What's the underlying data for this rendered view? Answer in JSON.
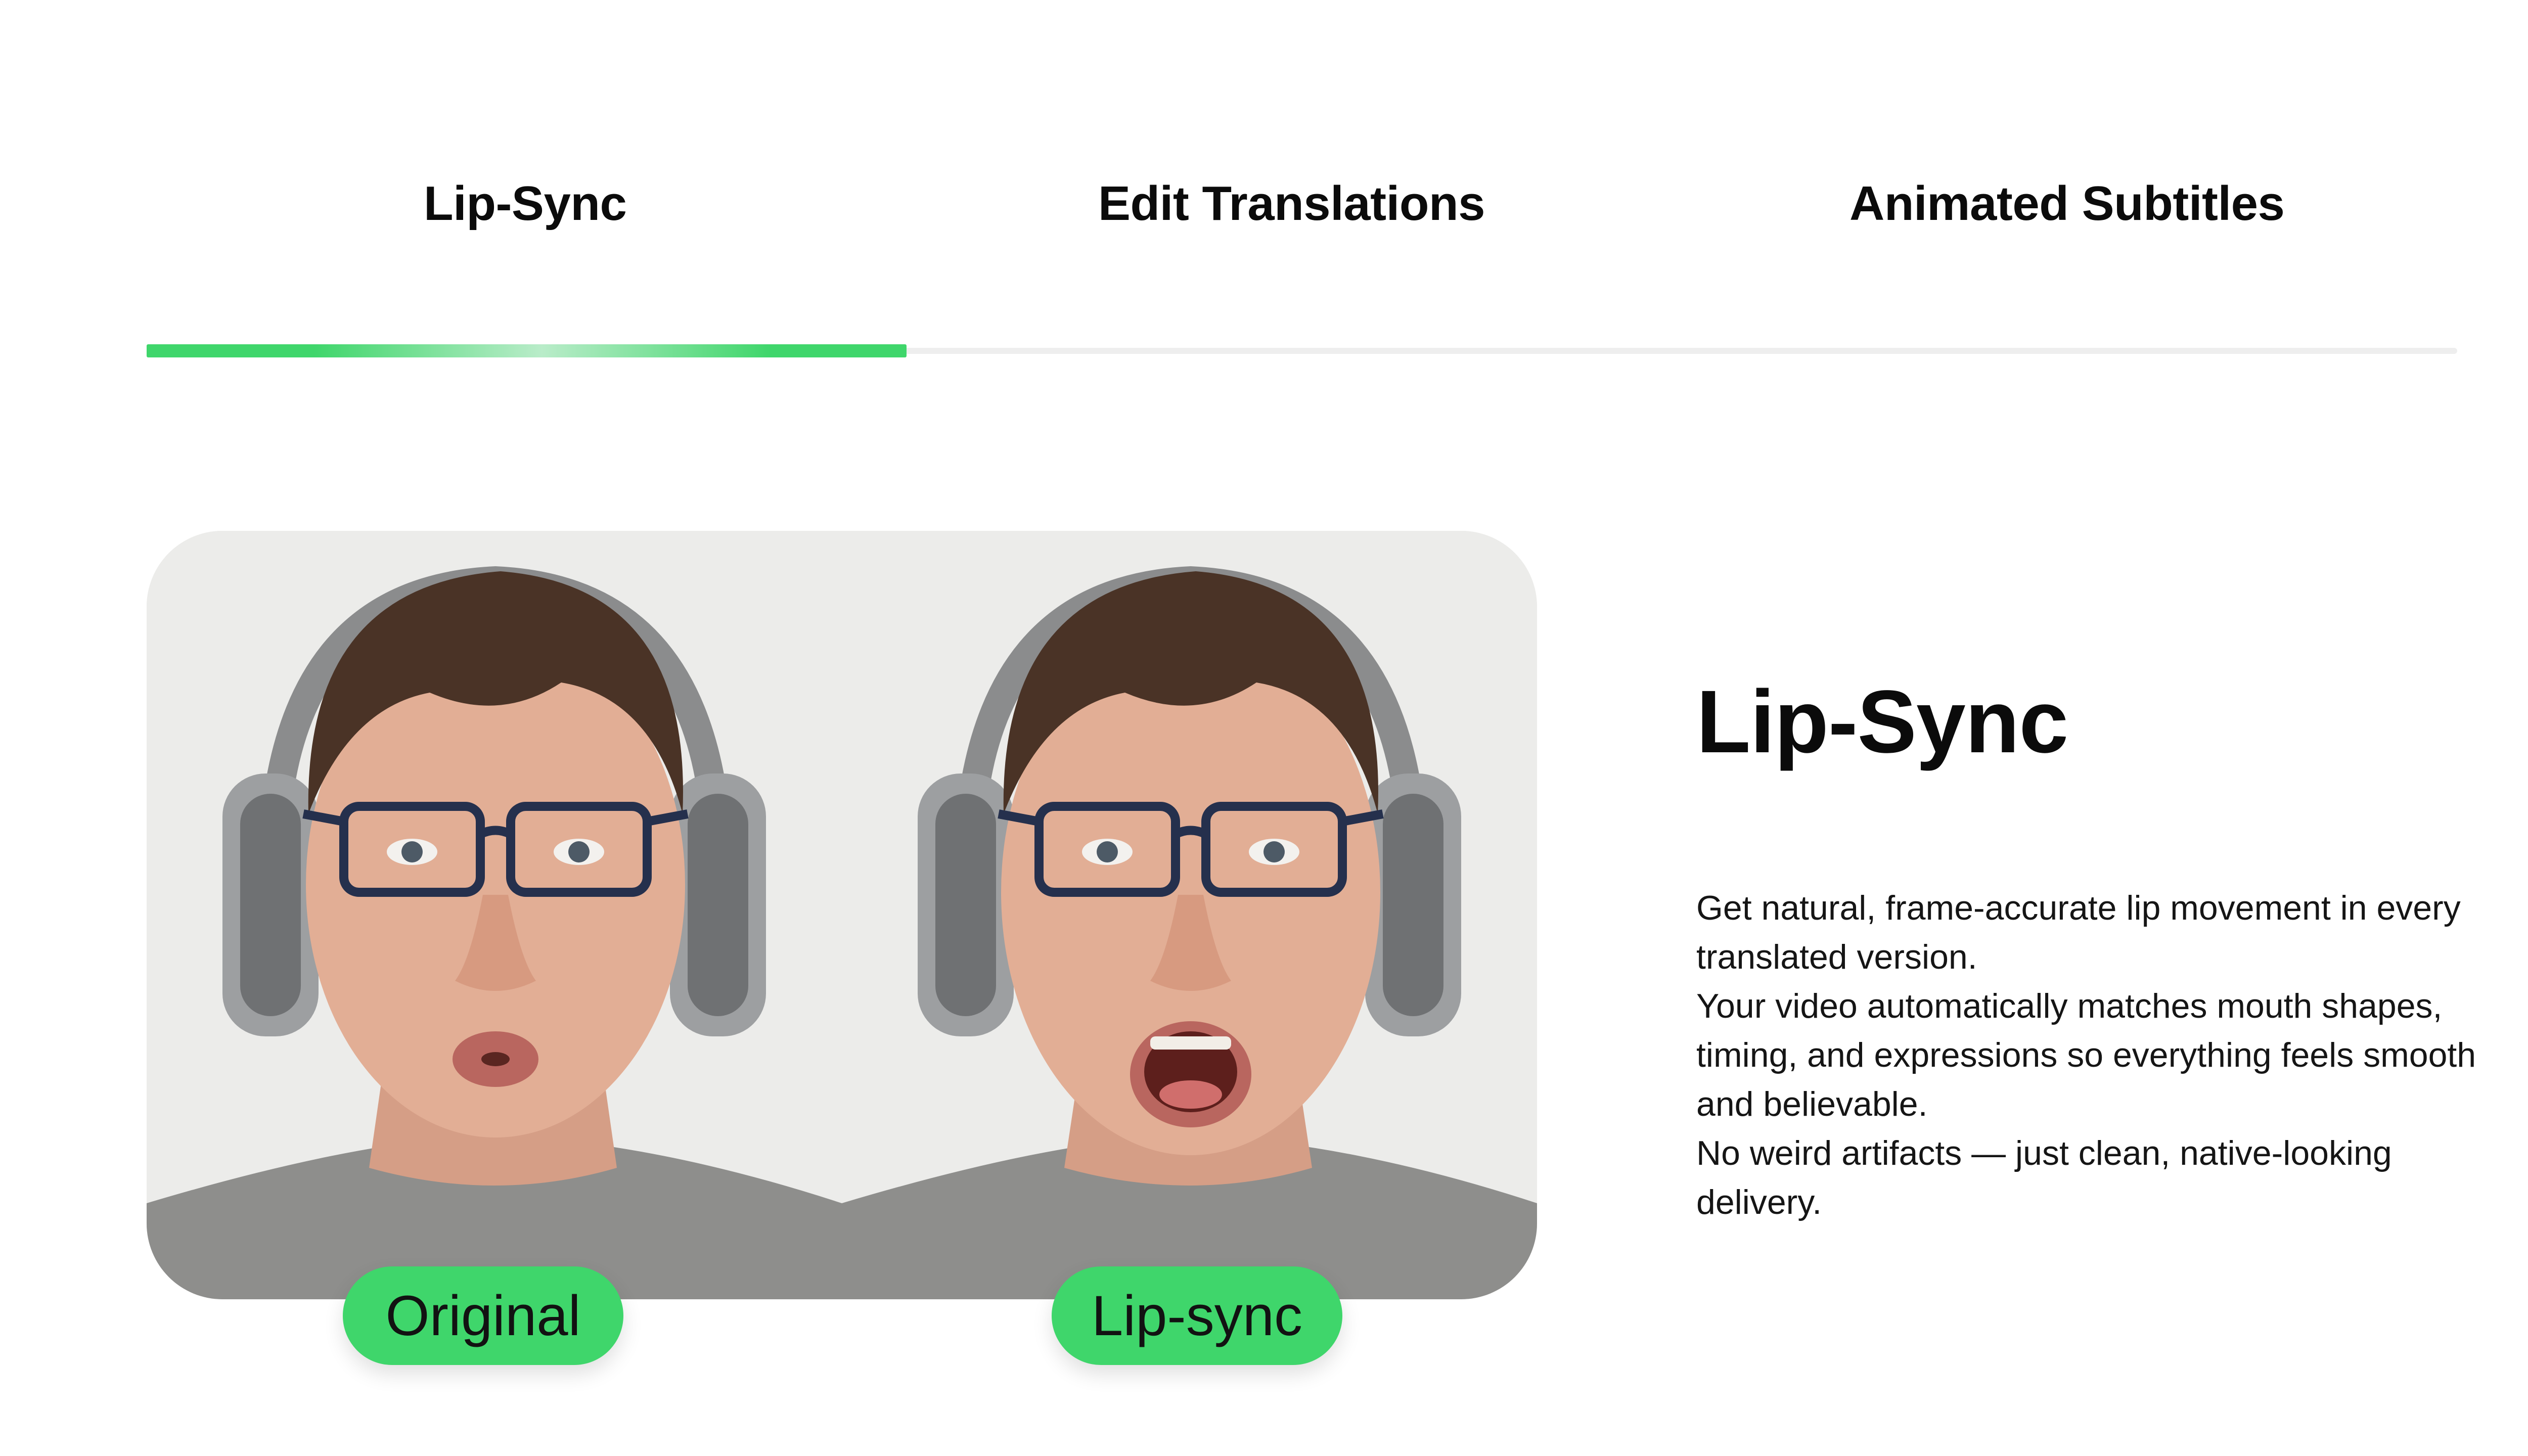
{
  "tabs": [
    {
      "label": "Lip-Sync",
      "active": true
    },
    {
      "label": "Edit Translations",
      "active": false
    },
    {
      "label": "Animated Subtitles",
      "active": false
    }
  ],
  "progress": {
    "active_fraction": 0.33,
    "accent": "#3fd66b",
    "track_color": "#eeeeee"
  },
  "comparison": {
    "original_label": "Original",
    "lipsync_label": "Lip-sync",
    "pill_color": "#3fd66b"
  },
  "feature": {
    "title": "Lip-Sync",
    "paragraphs": [
      "Get natural, frame-accurate lip movement in every translated version.",
      "Your video automatically matches mouth shapes, timing, and expressions so everything feels smooth and believable.",
      "No weird artifacts — just clean, native-looking delivery."
    ]
  }
}
